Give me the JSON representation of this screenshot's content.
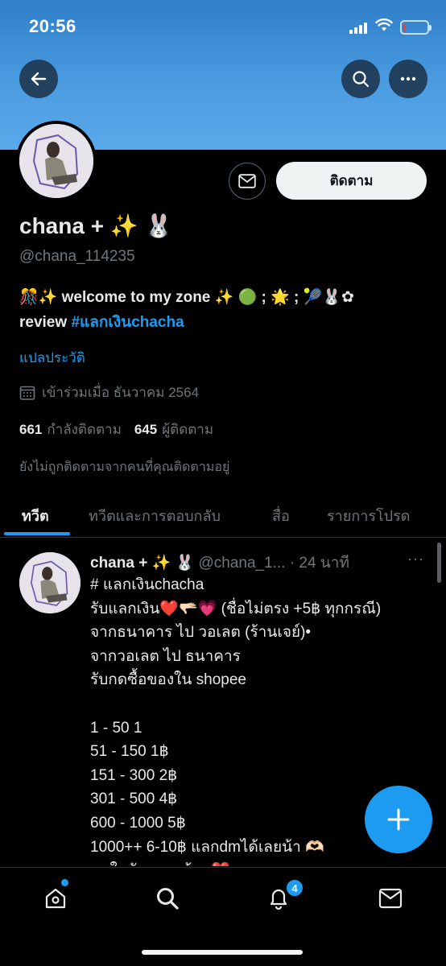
{
  "status_bar": {
    "time": "20:56",
    "battery_level": 0.1,
    "battery_color": "#ff3b30"
  },
  "header": {
    "back_icon": "arrow-left-icon",
    "search_icon": "search-icon",
    "more_icon": "more-horizontal-icon",
    "banner_color": "#4a9be0"
  },
  "profile": {
    "display_name": "chana + ✨ 🐰",
    "handle": "@chana_114235",
    "bio_line1": "🎊✨ welcome to my zone ✨ 🟢 ; 🌟 ; 🎾🐰✿",
    "bio_line2_text": "review ",
    "bio_hashtag": "#แลกเงินchacha",
    "translate_bio": "แปลประวัติ",
    "joined": "เข้าร่วมเมื่อ ธันวาคม 2564",
    "following_count": "661",
    "following_label": "กำลังติดตาม",
    "followers_count": "645",
    "followers_label": "ผู้ติดตาม",
    "not_followed_text": "ยังไม่ถูกติดตามจากคนที่คุณติดตามอยู่",
    "follow_button": "ติดตาม"
  },
  "tabs": [
    {
      "label": "ทวีต",
      "active": true
    },
    {
      "label": "ทวีตและการตอบกลับ",
      "active": false
    },
    {
      "label": "สื่อ",
      "active": false
    },
    {
      "label": "รายการโปรด",
      "active": false
    }
  ],
  "tweet": {
    "name": "chana + ✨ 🐰",
    "handle": "@chana_1...",
    "time": "· 24 นาที",
    "more": "···",
    "lines": [
      "# แลกเงินchacha",
      "รับแลกเงิน❤️🫳🏻💗 (ชื่อไม่ตรง +5฿ ทุกกรณี)",
      "จากธนาคาร ไป วอเลต (ร้านเจย์)•",
      "จากวอเลต ไป ธนาคาร",
      "รับกดซื้อของใน shopee",
      "",
      "1 - 50 1",
      "51 - 150 1฿",
      "151 - 300 2฿",
      "301 - 500 4฿",
      "600 - 1000 5฿",
      "1000++ 6-10฿ แลกdmได้เลยน้า 🫶🏻",
      "สนใจทักเลย พร้อม❤️"
    ]
  },
  "fab_icon": "plus-icon",
  "bottom_nav": {
    "items": [
      "home-icon",
      "search-icon",
      "notifications-icon",
      "messages-icon"
    ],
    "notification_count": "4",
    "accent_color": "#1d9bf0"
  }
}
